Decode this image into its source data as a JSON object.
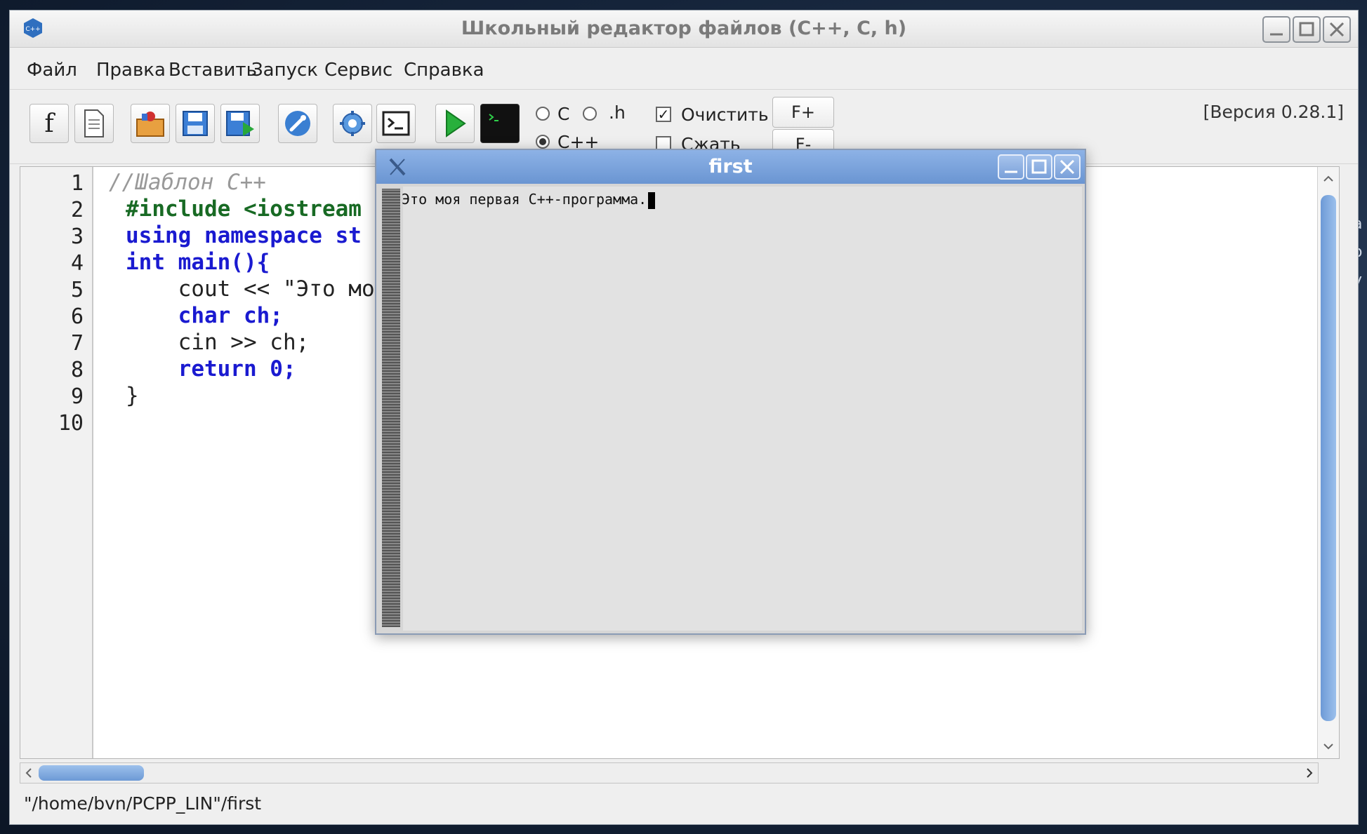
{
  "main_window": {
    "title": "Школьный редактор файлов (C++,  C, h)",
    "menu": [
      "Файл",
      "Правка",
      "Вставить",
      "Запуск",
      "Сервис",
      "Справка"
    ],
    "toolbar": {
      "buttons": [
        {
          "name": "font-f-button",
          "label": "f"
        },
        {
          "name": "new-file-button",
          "label": ""
        },
        {
          "name": "open-file-button",
          "label": ""
        },
        {
          "name": "save-button",
          "label": ""
        },
        {
          "name": "save-as-button",
          "label": ""
        },
        {
          "name": "settings-wrench-button",
          "label": ""
        },
        {
          "name": "options-gear-button",
          "label": ""
        },
        {
          "name": "terminal-button",
          "label": ""
        },
        {
          "name": "run-button",
          "label": ""
        },
        {
          "name": "console-run-button",
          "label": ""
        }
      ],
      "lang": {
        "c": "C",
        "h": ".h",
        "cpp": "C++",
        "selected": "C++"
      },
      "checkboxes": {
        "clear": {
          "label": "Очистить",
          "checked": true
        },
        "compress": {
          "label": "Сжать",
          "checked": false
        }
      },
      "font_plus": "F+",
      "font_minus": "F-",
      "version": "[Версия 0.28.1]"
    },
    "editor": {
      "line_numbers": [
        "1",
        "2",
        "3",
        "4",
        "5",
        "6",
        "7",
        "8",
        "9",
        "10"
      ],
      "lines": [
        "//Шаблон C++",
        "#include <iostream",
        "using namespace st",
        "int main(){",
        "    cout << \"Это мо",
        "    char ch;",
        "    cin >> ch;",
        "    return 0;",
        "}",
        ""
      ]
    },
    "status_path": "\"/home/bvn/PCPP_LIN\"/first"
  },
  "console_window": {
    "title": "first",
    "output": "Это моя первая C++-программа."
  },
  "colors": {
    "keyword": "#1a1ad0",
    "preprocessor": "#186a24",
    "number": "#d22222",
    "comment": "#999999",
    "console_title": "#7aa0d9"
  }
}
